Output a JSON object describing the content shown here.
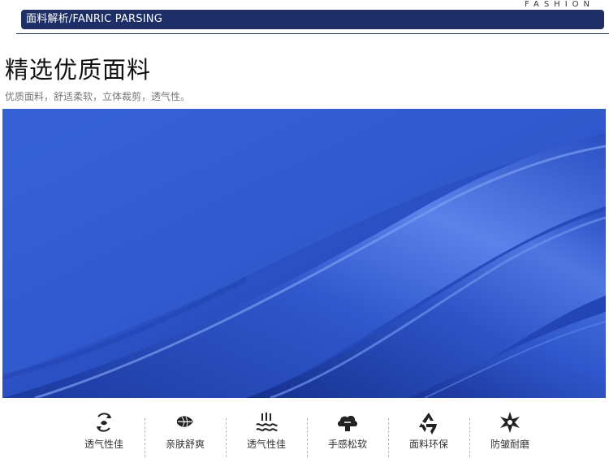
{
  "banner": {
    "title": "面料解析/FANRIC PARSING",
    "tag": "FASHION"
  },
  "heading": {
    "title": "精选优质面料",
    "subtitle": "优质面料，舒适柔软，立体裁剪，透气性。"
  },
  "photo": {
    "subject": "blue fabric close-up",
    "color": "#2f55c8"
  },
  "colors": {
    "banner": "#1d2f66",
    "fabric": "#2f55c8"
  },
  "features": [
    {
      "icon": "breathable-arrows-icon",
      "label": "透气性佳"
    },
    {
      "icon": "leaf-icon",
      "label": "亲肤舒爽"
    },
    {
      "icon": "moisture-wicking-icon",
      "label": "透气性佳"
    },
    {
      "icon": "cloud-soft-icon",
      "label": "手感松软"
    },
    {
      "icon": "recycle-icon",
      "label": "面料环保"
    },
    {
      "icon": "star-flower-icon",
      "label": "防皱耐磨"
    }
  ]
}
